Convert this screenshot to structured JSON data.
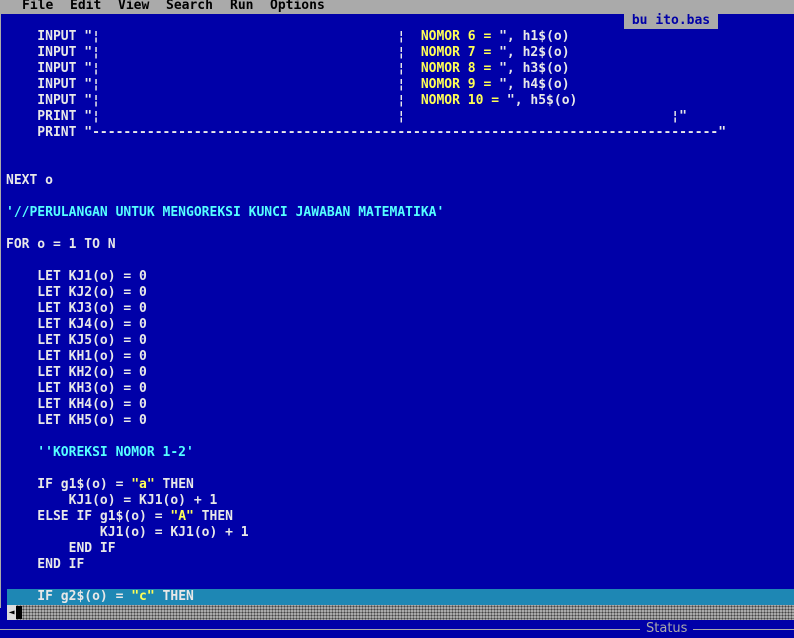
{
  "menu": {
    "file": "File",
    "edit": "Edit",
    "view": "View",
    "search": "Search",
    "run": "Run",
    "options": "Options"
  },
  "document": {
    "tab_title": "bu ito.bas"
  },
  "colors": {
    "background": "#0000a8",
    "menubar": "#aaaaaa",
    "text": "#e8e8e8",
    "string": "#ffff55",
    "comment": "#55ffff",
    "current_line": "#1e87b4"
  },
  "code": [
    [
      {
        "t": "    INPUT \"¦                                      ¦  ",
        "c": "w"
      },
      {
        "t": "NOMOR 6 = ",
        "c": "y"
      },
      {
        "t": "\", h1$(o)",
        "c": "w"
      }
    ],
    [
      {
        "t": "    INPUT \"¦                                      ¦  ",
        "c": "w"
      },
      {
        "t": "NOMOR 7 = ",
        "c": "y"
      },
      {
        "t": "\", h2$(o)",
        "c": "w"
      }
    ],
    [
      {
        "t": "    INPUT \"¦                                      ¦  ",
        "c": "w"
      },
      {
        "t": "NOMOR 8 = ",
        "c": "y"
      },
      {
        "t": "\", h3$(o)",
        "c": "w"
      }
    ],
    [
      {
        "t": "    INPUT \"¦                                      ¦  ",
        "c": "w"
      },
      {
        "t": "NOMOR 9 = ",
        "c": "y"
      },
      {
        "t": "\", h4$(o)",
        "c": "w"
      }
    ],
    [
      {
        "t": "    INPUT \"¦                                      ¦  ",
        "c": "w"
      },
      {
        "t": "NOMOR 10 = ",
        "c": "y"
      },
      {
        "t": "\", h5$(o)",
        "c": "w"
      }
    ],
    [
      {
        "t": "    PRINT \"¦                                      ¦                                  ¦\"",
        "c": "w"
      }
    ],
    [
      {
        "t": "    PRINT \"--------------------------------------------------------------------------------\"",
        "c": "w"
      }
    ],
    [
      {
        "t": "",
        "c": "w"
      }
    ],
    [
      {
        "t": "",
        "c": "w"
      }
    ],
    [
      {
        "t": "NEXT o",
        "c": "w"
      }
    ],
    [
      {
        "t": "",
        "c": "w"
      }
    ],
    [
      {
        "t": "'//PERULANGAN UNTUK MENGOREKSI KUNCI JAWABAN MATEMATIKA'",
        "c": "c"
      }
    ],
    [
      {
        "t": "",
        "c": "w"
      }
    ],
    [
      {
        "t": "FOR o = 1 TO N",
        "c": "w"
      }
    ],
    [
      {
        "t": "",
        "c": "w"
      }
    ],
    [
      {
        "t": "    LET KJ1(o) = 0",
        "c": "w"
      }
    ],
    [
      {
        "t": "    LET KJ2(o) = 0",
        "c": "w"
      }
    ],
    [
      {
        "t": "    LET KJ3(o) = 0",
        "c": "w"
      }
    ],
    [
      {
        "t": "    LET KJ4(o) = 0",
        "c": "w"
      }
    ],
    [
      {
        "t": "    LET KJ5(o) = 0",
        "c": "w"
      }
    ],
    [
      {
        "t": "    LET KH1(o) = 0",
        "c": "w"
      }
    ],
    [
      {
        "t": "    LET KH2(o) = 0",
        "c": "w"
      }
    ],
    [
      {
        "t": "    LET KH3(o) = 0",
        "c": "w"
      }
    ],
    [
      {
        "t": "    LET KH4(o) = 0",
        "c": "w"
      }
    ],
    [
      {
        "t": "    LET KH5(o) = 0",
        "c": "w"
      }
    ],
    [
      {
        "t": "",
        "c": "w"
      }
    ],
    [
      {
        "t": "    ''KOREKSI NOMOR 1-2'",
        "c": "c"
      }
    ],
    [
      {
        "t": "",
        "c": "w"
      }
    ],
    [
      {
        "t": "    IF g1$(o) = ",
        "c": "w"
      },
      {
        "t": "\"a\"",
        "c": "y"
      },
      {
        "t": " THEN",
        "c": "w"
      }
    ],
    [
      {
        "t": "        KJ1(o) = KJ1(o) + 1",
        "c": "w"
      }
    ],
    [
      {
        "t": "    ELSE IF g1$(o) = ",
        "c": "w"
      },
      {
        "t": "\"A\"",
        "c": "y"
      },
      {
        "t": " THEN",
        "c": "w"
      }
    ],
    [
      {
        "t": "            KJ1(o) = KJ1(o) + 1",
        "c": "w"
      }
    ],
    [
      {
        "t": "        END IF",
        "c": "w"
      }
    ],
    [
      {
        "t": "    END IF",
        "c": "w"
      }
    ],
    [
      {
        "t": "",
        "c": "w"
      }
    ],
    [
      {
        "t": "    IF g2$(o) = ",
        "c": "w"
      },
      {
        "t": "\"c\"",
        "c": "y"
      },
      {
        "t": " THEN",
        "c": "w"
      }
    ]
  ],
  "status": {
    "label": "Status"
  }
}
